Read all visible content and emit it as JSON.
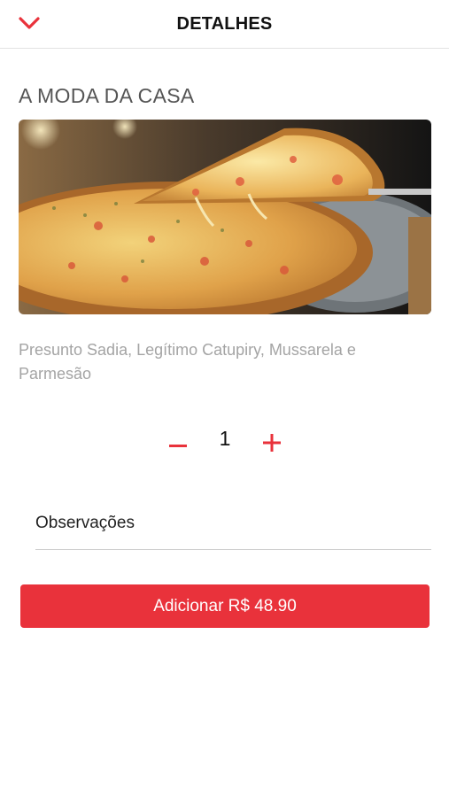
{
  "header": {
    "title": "DETALHES",
    "back_icon": "chevron-down-icon",
    "accent_color": "#e9323b"
  },
  "product": {
    "name": "A MODA DA CASA",
    "image_subject": "pizza-photo",
    "description": "Presunto Sadia, Legítimo Catupiry, Mussarela e Parmesão"
  },
  "quantity": {
    "value": "1",
    "decrement_icon": "minus-icon",
    "increment_icon": "plus-icon"
  },
  "observations": {
    "placeholder": "Observações"
  },
  "add_button": {
    "label": "Adicionar R$ 48.90",
    "color": "#e9323b"
  }
}
